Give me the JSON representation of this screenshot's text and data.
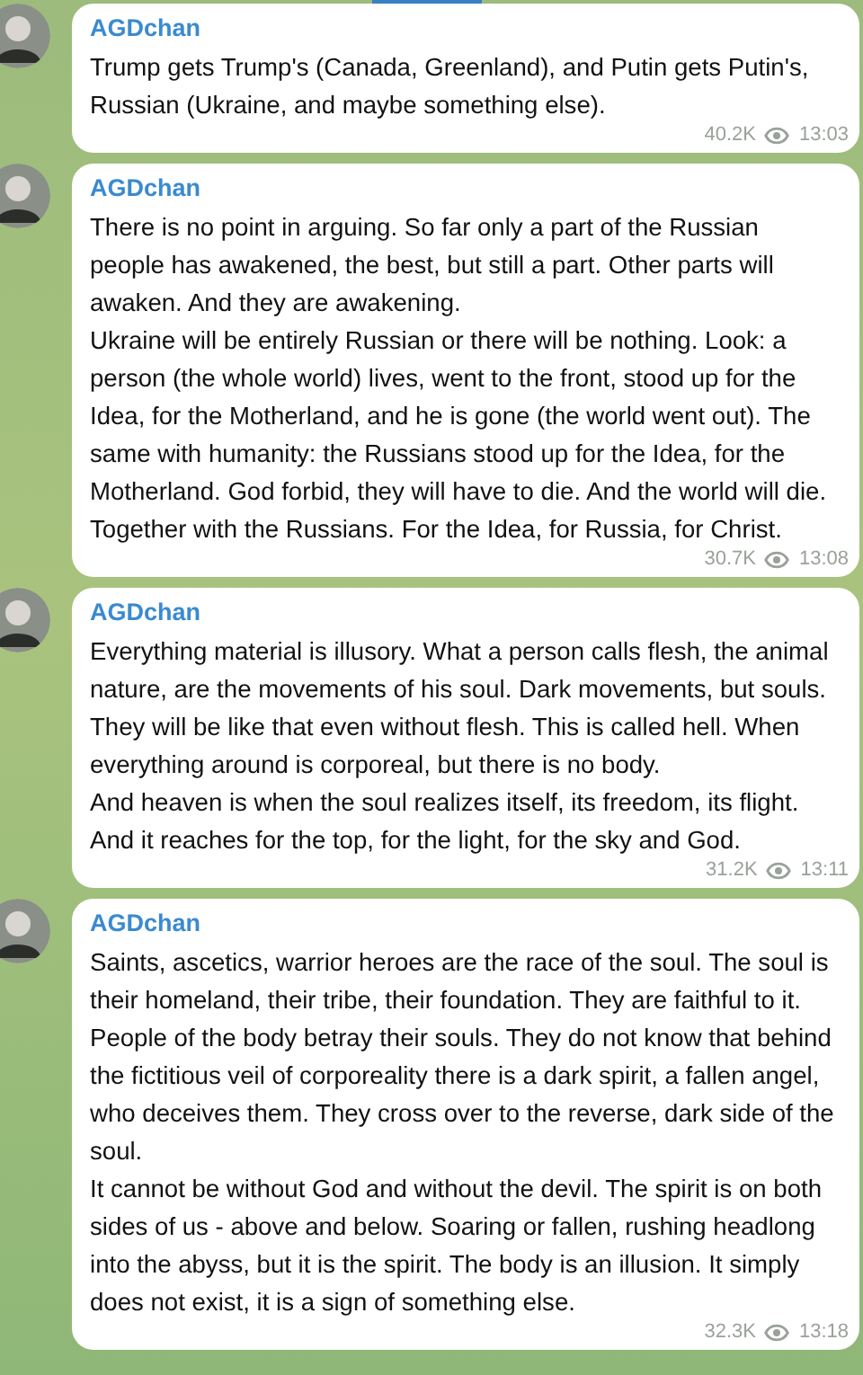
{
  "messages": [
    {
      "sender": "AGDchan",
      "paragraphs": [
        "Trump gets Trump's (Canada, Greenland), and Putin gets Putin's, Russian (Ukraine, and maybe something else)."
      ],
      "views": "40.2K",
      "time": "13:03"
    },
    {
      "sender": "AGDchan",
      "paragraphs": [
        "There is no point in arguing. So far only a part of the Russian people has awakened, the best, but still a part. Other parts will awaken. And they are awakening.",
        "Ukraine will be entirely Russian or there will be nothing. Look: a person (the whole world) lives, went to the front, stood up for the Idea, for the Motherland, and he is gone (the world went out). The same with humanity: the Russians stood up for the Idea, for the Motherland. God forbid, they will have to die. And the world will die. Together with the Russians. For the Idea, for Russia, for Christ."
      ],
      "views": "30.7K",
      "time": "13:08"
    },
    {
      "sender": "AGDchan",
      "paragraphs": [
        "Everything material is illusory. What a person calls flesh, the animal nature, are the movements of his soul. Dark movements, but souls. They will be like that even without flesh. This is called hell. When everything around is corporeal, but there is no body.",
        "And heaven is when the soul realizes itself, its freedom, its flight. And it reaches for the top, for the light, for the sky and God."
      ],
      "views": "31.2K",
      "time": "13:11"
    },
    {
      "sender": "AGDchan",
      "paragraphs": [
        "Saints, ascetics, warrior heroes are the race of the soul. The soul is their homeland, their tribe, their foundation. They are faithful to it. People of the body betray their souls. They do not know that behind the fictitious veil of corporeality there is a dark spirit, a fallen angel, who deceives them. They cross over to the reverse, dark side of the soul.",
        "It cannot be without God and without the devil. The spirit is on both sides of us - above and below. Soaring or fallen, rushing headlong into the abyss, but it is the spirit. The body is an illusion. It simply does not exist, it is a sign of something else."
      ],
      "views": "32.3K",
      "time": "13:18"
    }
  ]
}
